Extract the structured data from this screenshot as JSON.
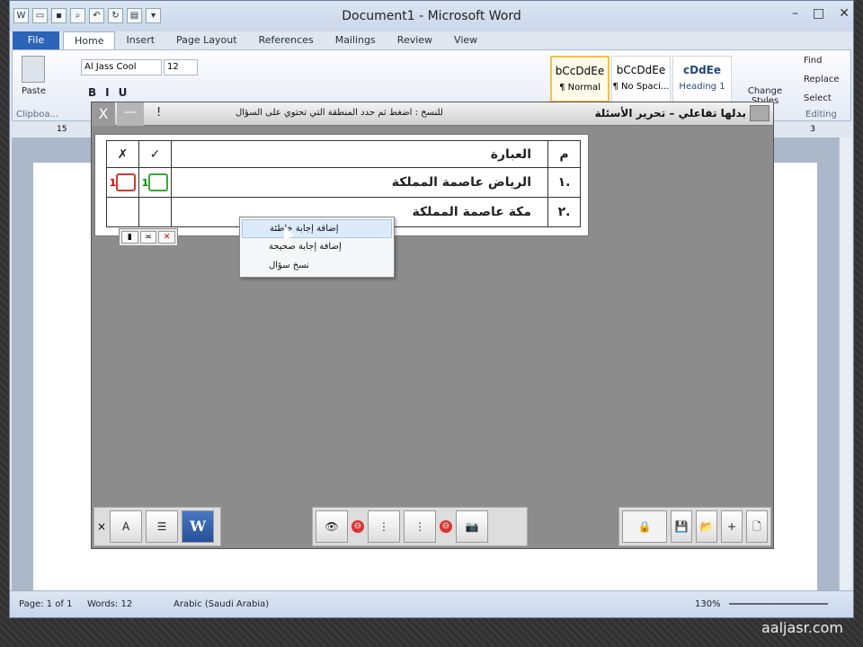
{
  "titlebar": {
    "title": "Document1  -  Microsoft Word",
    "icons": [
      "word-icon",
      "save-icon",
      "open-icon",
      "print-preview-icon",
      "undo-icon",
      "redo-icon",
      "quick-print-icon",
      "customize-icon"
    ],
    "buttons": {
      "minimize": "–",
      "restore": "□",
      "close": "✕"
    }
  },
  "tabs": [
    "File",
    "Home",
    "Insert",
    "Page Layout",
    "References",
    "Mailings",
    "Review",
    "View"
  ],
  "ribbon": {
    "paste": "Paste",
    "clipboard": "Clipboa...",
    "font_name": "Al Jass Cool",
    "font_size": "12",
    "styles": [
      {
        "sample": "bCcDdEe",
        "name": "¶ Normal"
      },
      {
        "sample": "bCcDdEe",
        "name": "¶ No Spaci..."
      },
      {
        "sample": "cDdEe",
        "name": "Heading 1"
      }
    ],
    "change_styles": "Change Styles",
    "find": "Find",
    "replace": "Replace",
    "select": "Select",
    "editing": "Editing"
  },
  "ruler": {
    "left": "15",
    "right": "3"
  },
  "dialog": {
    "title": "بدلها تفاعلي – تحرير الأسئلة",
    "instruction": "للنسخ : اضغط ثم حدد المنطقة التي تحتوي على السؤال",
    "close": "X",
    "minimize": "—",
    "pin": "!",
    "table": {
      "col_num": "م",
      "col_statement": "العبارة",
      "col_check": "✓",
      "col_cross": "✗",
      "rows": [
        {
          "num": "١.",
          "text": "الرياض عاصمة المملكة",
          "count_right": "1",
          "count_wrong": "1"
        },
        {
          "num": "٢.",
          "text": "مكة عاصمة المملكة"
        }
      ]
    },
    "context_menu": [
      "إضافة إجابة خاطئة",
      "إضافة إجابة صحيحة",
      "نسخ سؤال"
    ],
    "mini_toolbar": [
      "▮",
      "≍",
      "✕"
    ]
  },
  "bottom_toolbar": {
    "close": "×",
    "left": [
      "A",
      "☰",
      "W"
    ],
    "mid": [
      "👁",
      "⊖",
      "⋮",
      "⊖",
      "📷"
    ],
    "right": [
      "🔒",
      "💾",
      "📂",
      "+",
      "🗋"
    ]
  },
  "status": {
    "page": "Page: 1 of 1",
    "words": "Words: 12",
    "lang": "Arabic (Saudi Arabia)",
    "zoom": "130%"
  },
  "watermark": "aaljasr.com"
}
